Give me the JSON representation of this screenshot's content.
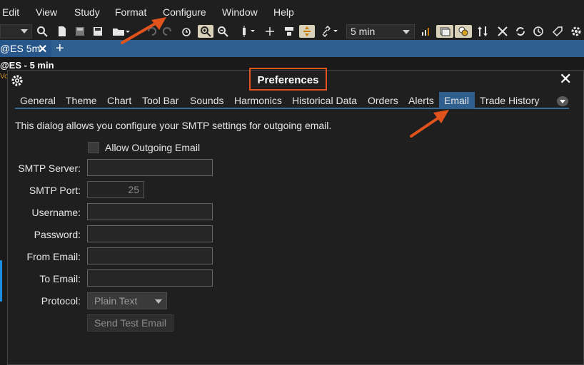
{
  "menu": [
    "Edit",
    "View",
    "Study",
    "Format",
    "Configure",
    "Window",
    "Help"
  ],
  "toolbar": {
    "interval": "5 min",
    "icons": [
      "search-icon",
      "new-page-icon",
      "save-icon",
      "save-as-icon",
      "open-folder-icon",
      "undo-icon",
      "redo-icon",
      "alarm-icon",
      "zoom-in-icon",
      "zoom-out-icon",
      "bar-style-icon",
      "crosshair-icon",
      "cursor-data-icon",
      "auto-scale-icon",
      "link-icon",
      "chart-type-icon",
      "window-icon",
      "circles-icon",
      "up-down-icon",
      "tools-icon",
      "refresh-icon",
      "history-icon",
      "tag-icon",
      "settings-icon"
    ]
  },
  "chart": {
    "tab_label": "@ES 5m",
    "tab_close": "✕",
    "add_tab": "+",
    "symbol_title": "@ES - 5 min",
    "sub_label": "Vo"
  },
  "dialog": {
    "title": "Preferences",
    "close": "✕",
    "tabs": [
      "General",
      "Theme",
      "Chart",
      "Tool Bar",
      "Sounds",
      "Harmonics",
      "Historical Data",
      "Orders",
      "Alerts",
      "Email",
      "Trade History"
    ],
    "active_tab": "Email",
    "description": "This dialog allows you configure your SMTP settings for outgoing email.",
    "allow_outgoing_label": "Allow Outgoing Email",
    "allow_outgoing_checked": false,
    "fields": {
      "smtp_server_label": "SMTP Server:",
      "smtp_server_value": "",
      "smtp_port_label": "SMTP Port:",
      "smtp_port_value": "25",
      "username_label": "Username:",
      "username_value": "",
      "password_label": "Password:",
      "password_value": "",
      "from_email_label": "From Email:",
      "from_email_value": "",
      "to_email_label": "To Email:",
      "to_email_value": "",
      "protocol_label": "Protocol:",
      "protocol_value": "Plain Text"
    },
    "test_button": "Send Test Email"
  },
  "colors": {
    "accent_blue": "#2f5f8f",
    "annotation_orange": "#e0531c",
    "background": "#1f1f1f"
  }
}
